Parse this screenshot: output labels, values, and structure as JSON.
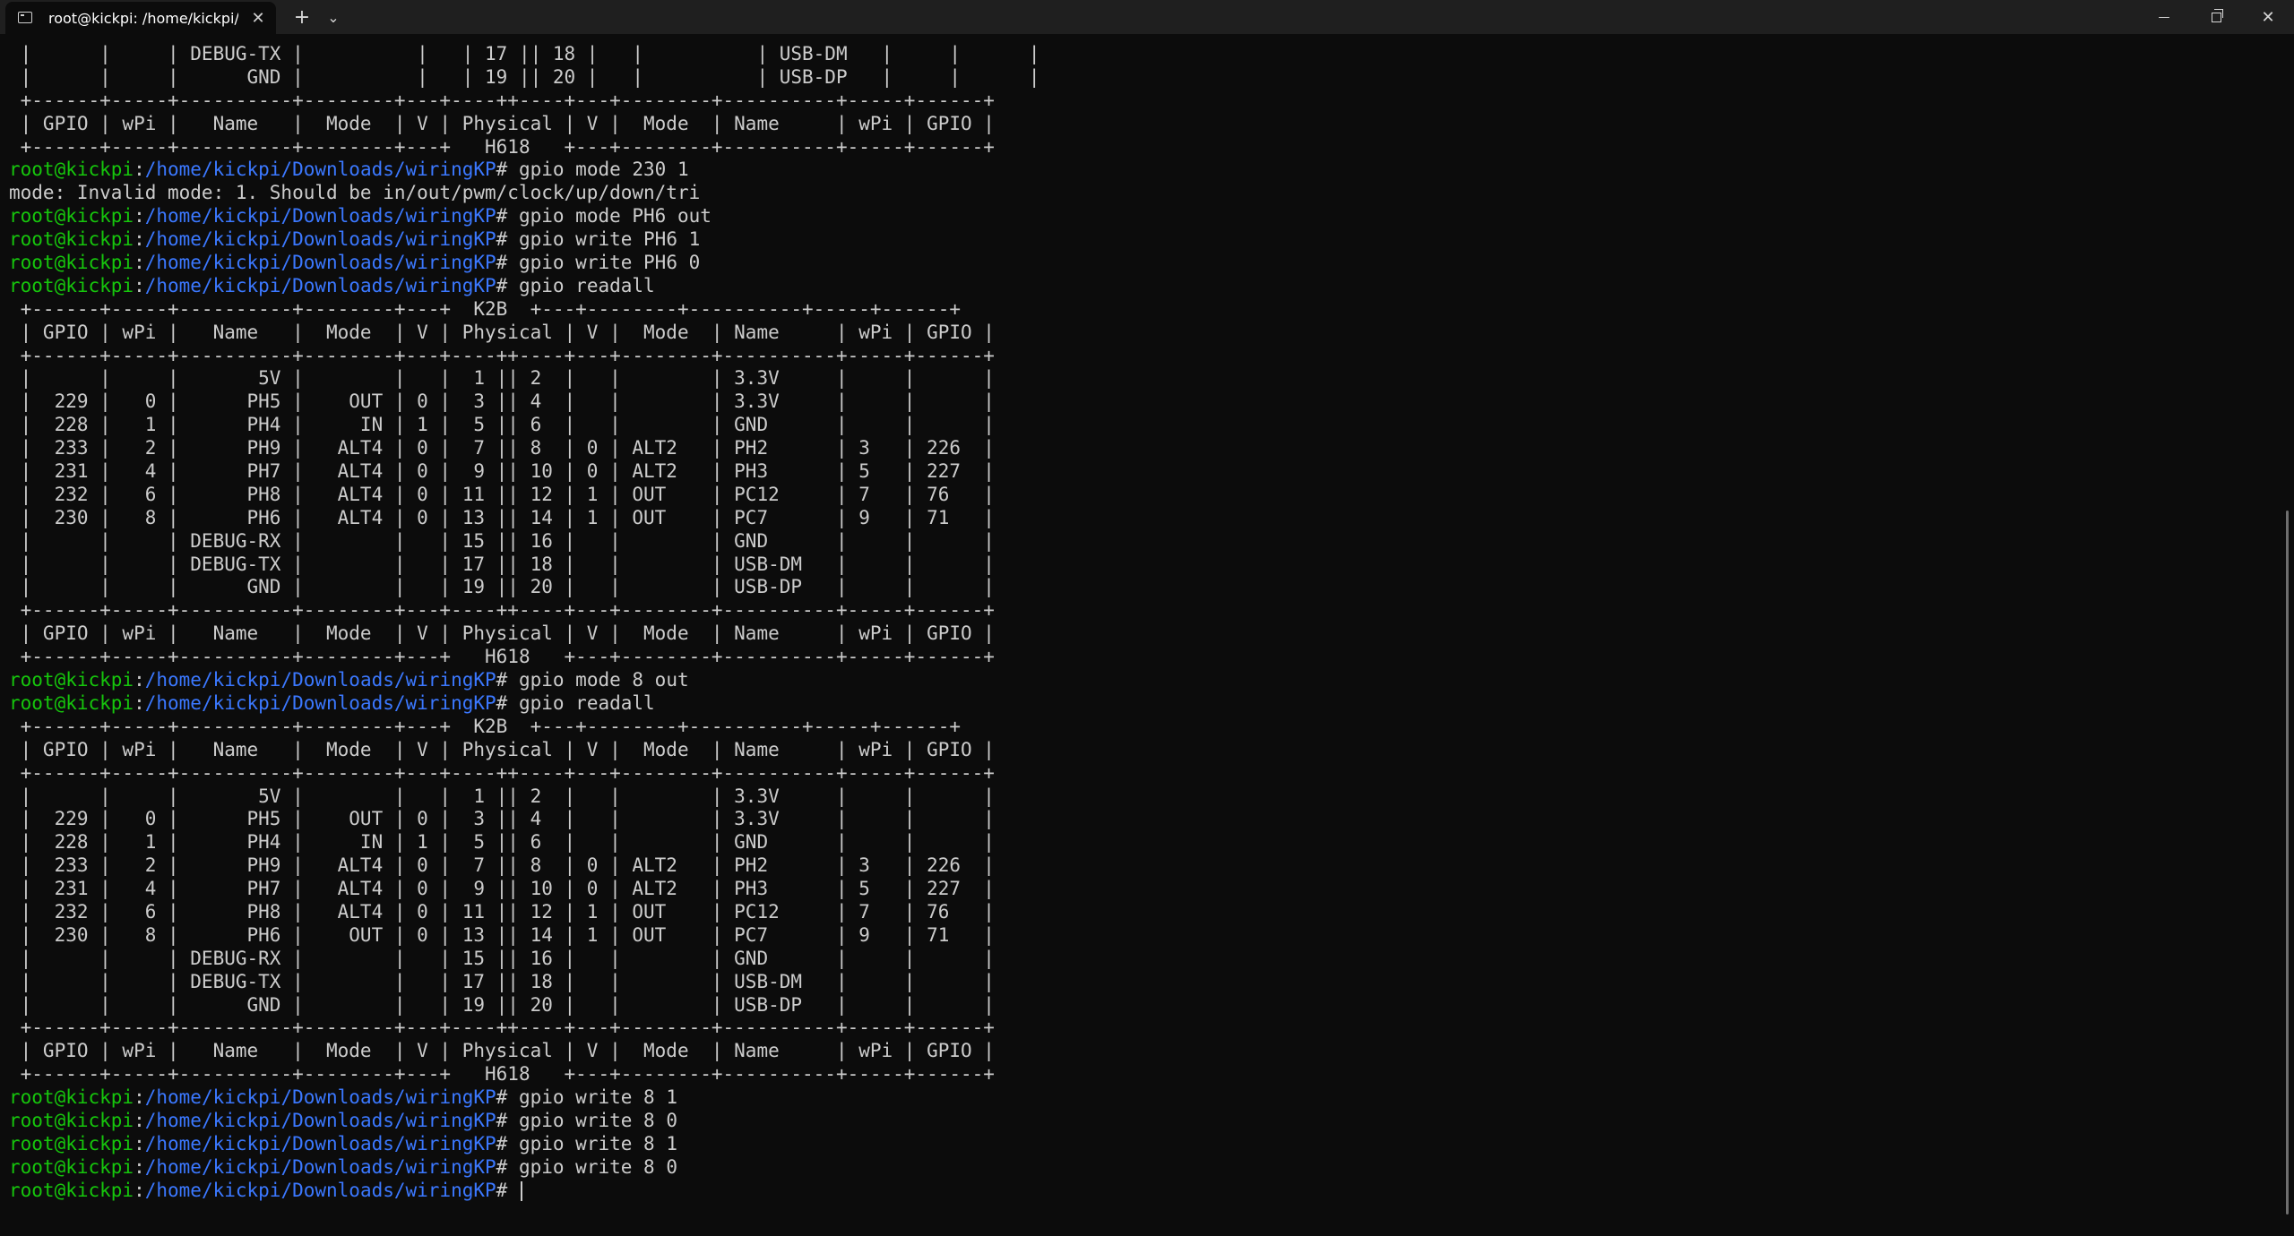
{
  "window": {
    "tab_title": "root@kickpi: /home/kickpi/Downloads/wiringKP",
    "icons": {
      "tab": "terminal-icon",
      "close": "close-icon",
      "new_tab": "plus-icon",
      "dropdown": "chevron-down-icon",
      "minimize": "minimize-icon",
      "maximize": "restore-icon",
      "window_close": "close-icon"
    },
    "buttons": {
      "close_glyph": "✕",
      "new_tab_glyph": "+",
      "dropdown_glyph": "⌄",
      "minimize_glyph": "—",
      "window_close_glyph": "✕"
    }
  },
  "colors": {
    "background": "#0c0c0c",
    "text": "#cccccc",
    "prompt_user": "#16c60c",
    "prompt_path": "#3b78ff"
  },
  "prompt": {
    "user": "root@kickpi",
    "sep": ":",
    "path": "/home/kickpi/Downloads/wiringKP",
    "symbol": "# "
  },
  "terminal": {
    "lines": [
      {
        "text": " |      |     | DEBUG-TX |          |   | 17 || 18 |   |          | USB-DM   |     |      |"
      },
      {
        "text": " |      |     |      GND |          |   | 19 || 20 |   |          | USB-DP   |     |      |"
      },
      {
        "text": " +------+-----+----------+--------+---+----++----+---+--------+----------+-----+------+"
      },
      {
        "text": " | GPIO | wPi |   Name   |  Mode  | V | Physical | V |  Mode  | Name     | wPi | GPIO |"
      },
      {
        "text": " +------+-----+----------+--------+---+   H618   +---+--------+----------+-----+------+"
      },
      {
        "cmd": "gpio mode 230 1"
      },
      {
        "text": "mode: Invalid mode: 1. Should be in/out/pwm/clock/up/down/tri"
      },
      {
        "cmd": "gpio mode PH6 out"
      },
      {
        "cmd": "gpio write PH6 1"
      },
      {
        "cmd": "gpio write PH6 0"
      },
      {
        "cmd": "gpio readall"
      },
      {
        "text": " +------+-----+----------+--------+---+  K2B  +---+--------+----------+-----+------+"
      },
      {
        "text": " | GPIO | wPi |   Name   |  Mode  | V | Physical | V |  Mode  | Name     | wPi | GPIO |"
      },
      {
        "text": " +------+-----+----------+--------+---+----++----+---+--------+----------+-----+------+"
      },
      {
        "text": " |      |     |       5V |        |   |  1 || 2  |   |        | 3.3V     |     |      |"
      },
      {
        "text": " |  229 |   0 |      PH5 |    OUT | 0 |  3 || 4  |   |        | 3.3V     |     |      |"
      },
      {
        "text": " |  228 |   1 |      PH4 |     IN | 1 |  5 || 6  |   |        | GND      |     |      |"
      },
      {
        "text": " |  233 |   2 |      PH9 |   ALT4 | 0 |  7 || 8  | 0 | ALT2   | PH2      | 3   | 226  |"
      },
      {
        "text": " |  231 |   4 |      PH7 |   ALT4 | 0 |  9 || 10 | 0 | ALT2   | PH3      | 5   | 227  |"
      },
      {
        "text": " |  232 |   6 |      PH8 |   ALT4 | 0 | 11 || 12 | 1 | OUT    | PC12     | 7   | 76   |"
      },
      {
        "text": " |  230 |   8 |      PH6 |   ALT4 | 0 | 13 || 14 | 1 | OUT    | PC7      | 9   | 71   |"
      },
      {
        "text": " |      |     | DEBUG-RX |        |   | 15 || 16 |   |        | GND      |     |      |"
      },
      {
        "text": " |      |     | DEBUG-TX |        |   | 17 || 18 |   |        | USB-DM   |     |      |"
      },
      {
        "text": " |      |     |      GND |        |   | 19 || 20 |   |        | USB-DP   |     |      |"
      },
      {
        "text": " +------+-----+----------+--------+---+----++----+---+--------+----------+-----+------+"
      },
      {
        "text": " | GPIO | wPi |   Name   |  Mode  | V | Physical | V |  Mode  | Name     | wPi | GPIO |"
      },
      {
        "text": " +------+-----+----------+--------+---+   H618   +---+--------+----------+-----+------+"
      },
      {
        "cmd": "gpio mode 8 out"
      },
      {
        "cmd": "gpio readall"
      },
      {
        "text": " +------+-----+----------+--------+---+  K2B  +---+--------+----------+-----+------+"
      },
      {
        "text": " | GPIO | wPi |   Name   |  Mode  | V | Physical | V |  Mode  | Name     | wPi | GPIO |"
      },
      {
        "text": " +------+-----+----------+--------+---+----++----+---+--------+----------+-----+------+"
      },
      {
        "text": " |      |     |       5V |        |   |  1 || 2  |   |        | 3.3V     |     |      |"
      },
      {
        "text": " |  229 |   0 |      PH5 |    OUT | 0 |  3 || 4  |   |        | 3.3V     |     |      |"
      },
      {
        "text": " |  228 |   1 |      PH4 |     IN | 1 |  5 || 6  |   |        | GND      |     |      |"
      },
      {
        "text": " |  233 |   2 |      PH9 |   ALT4 | 0 |  7 || 8  | 0 | ALT2   | PH2      | 3   | 226  |"
      },
      {
        "text": " |  231 |   4 |      PH7 |   ALT4 | 0 |  9 || 10 | 0 | ALT2   | PH3      | 5   | 227  |"
      },
      {
        "text": " |  232 |   6 |      PH8 |   ALT4 | 0 | 11 || 12 | 1 | OUT    | PC12     | 7   | 76   |"
      },
      {
        "text": " |  230 |   8 |      PH6 |    OUT | 0 | 13 || 14 | 1 | OUT    | PC7      | 9   | 71   |"
      },
      {
        "text": " |      |     | DEBUG-RX |        |   | 15 || 16 |   |        | GND      |     |      |"
      },
      {
        "text": " |      |     | DEBUG-TX |        |   | 17 || 18 |   |        | USB-DM   |     |      |"
      },
      {
        "text": " |      |     |      GND |        |   | 19 || 20 |   |        | USB-DP   |     |      |"
      },
      {
        "text": " +------+-----+----------+--------+---+----++----+---+--------+----------+-----+------+"
      },
      {
        "text": " | GPIO | wPi |   Name   |  Mode  | V | Physical | V |  Mode  | Name     | wPi | GPIO |"
      },
      {
        "text": " +------+-----+----------+--------+---+   H618   +---+--------+----------+-----+------+"
      },
      {
        "cmd": "gpio write 8 1"
      },
      {
        "cmd": "gpio write 8 0"
      },
      {
        "cmd": "gpio write 8 1"
      },
      {
        "cmd": "gpio write 8 0"
      },
      {
        "cmd": "",
        "cursor": true
      }
    ]
  }
}
